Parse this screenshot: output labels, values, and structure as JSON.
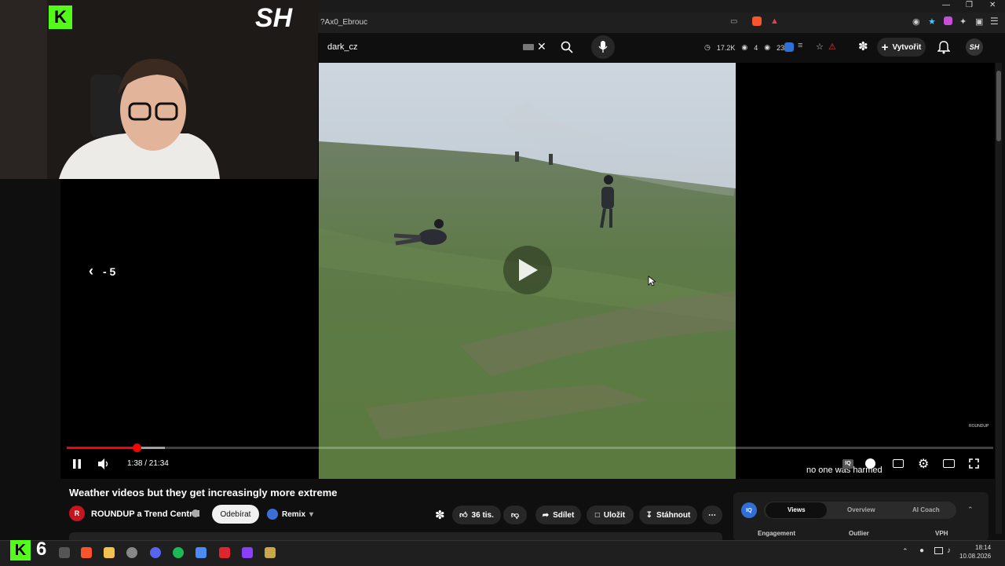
{
  "browser": {
    "url_fragment": "?Ax0_Ebrouc"
  },
  "header": {
    "search_value": "dark_cz",
    "stats": {
      "views_short": "17.2K",
      "count_a": "4",
      "count_b": "236"
    },
    "create_label": "Vytvořit"
  },
  "player": {
    "time_display": "1:38 / 21:34",
    "progress_fraction": 0.076,
    "seek_label": "- 5",
    "caption": "no one was harmed",
    "watermark": "ROUNDUP"
  },
  "video_info": {
    "title": "Weather videos but they get increasingly more extreme",
    "channel_name": "ROUNDUP a Trend Central",
    "channel_avatar_letter": "R",
    "subscribe_label": "Odebírat",
    "remix_label": "Remix",
    "like_count": "36 tis.",
    "share_label": "Sdílet",
    "save_label": "Uložit",
    "download_label": "Stáhnout"
  },
  "iq_panel": {
    "badge": "IQ",
    "tabs": [
      "Views",
      "Overview",
      "AI Coach"
    ],
    "columns": [
      "Engagement",
      "Outlier",
      "VPH"
    ]
  },
  "overlay": {
    "kick_letter": "K",
    "sh_logo": "SH",
    "taskbar_number": "6"
  },
  "taskbar": {
    "time": "18:14",
    "date": "10.08.2026"
  },
  "colors": {
    "progress": "#ff0000",
    "kick_green": "#53fc18",
    "grass": "#5d7a45",
    "sky": "#c9d3dc"
  }
}
